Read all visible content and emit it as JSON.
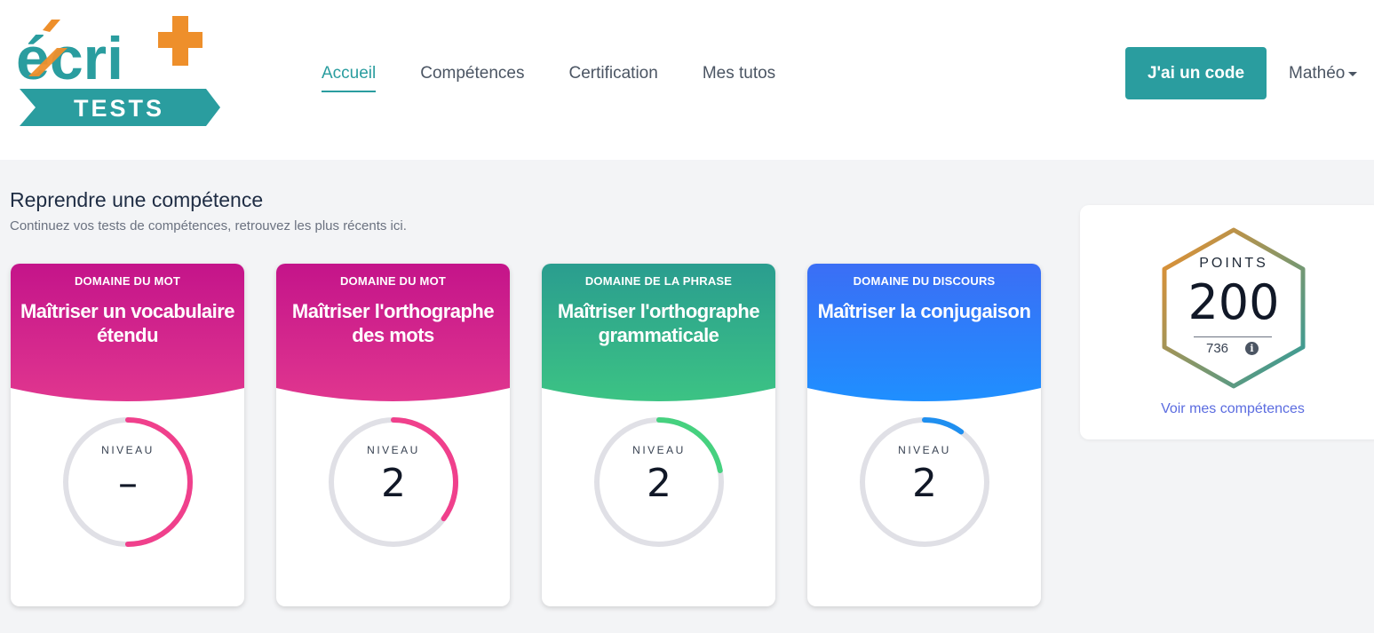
{
  "logo": {
    "word": "écri",
    "plus": "+",
    "badge": "TESTS"
  },
  "nav": [
    {
      "label": "Accueil",
      "active": true
    },
    {
      "label": "Compétences",
      "active": false
    },
    {
      "label": "Certification",
      "active": false
    },
    {
      "label": "Mes tutos",
      "active": false
    }
  ],
  "header": {
    "code_button": "J'ai un code",
    "user_name": "Mathéo"
  },
  "section": {
    "title": "Reprendre une compétence",
    "subtitle": "Continuez vos tests de compétences, retrouvez les plus récents ici."
  },
  "cards": [
    {
      "domain": "DOMAINE DU MOT",
      "title_line1": "Maîtriser un vocabulaire",
      "title_line2": "étendu",
      "level_label": "NIVEAU",
      "level": "–",
      "progress": 0.5,
      "color_start": "#c4148a",
      "color_end": "#e0368f",
      "ring_color": "#f0408c"
    },
    {
      "domain": "DOMAINE DU MOT",
      "title_line1": "Maîtriser l'orthographe",
      "title_line2": "des mots",
      "level_label": "NIVEAU",
      "level": "2",
      "progress": 0.35,
      "color_start": "#c4148a",
      "color_end": "#e0368f",
      "ring_color": "#f0408c"
    },
    {
      "domain": "DOMAINE DE LA PHRASE",
      "title_line1": "Maîtriser l'orthographe",
      "title_line2": "grammaticale",
      "level_label": "NIVEAU",
      "level": "2",
      "progress": 0.22,
      "color_start": "#2a9d8f",
      "color_end": "#3cc384",
      "ring_color": "#46d17f"
    },
    {
      "domain": "DOMAINE DU DISCOURS",
      "title_line1": "Maîtriser la conjugaison",
      "title_line2": "",
      "level_label": "NIVEAU",
      "level": "2",
      "progress": 0.1,
      "color_start": "#3b6ef5",
      "color_end": "#1f8fff",
      "ring_color": "#1f8ff0"
    }
  ],
  "points": {
    "label": "POINTS",
    "value": "200",
    "total": "736",
    "link": "Voir mes compétences"
  },
  "colors": {
    "accent": "#2a9d9f",
    "orange": "#ee8f2b",
    "link": "#5b6ce0"
  }
}
